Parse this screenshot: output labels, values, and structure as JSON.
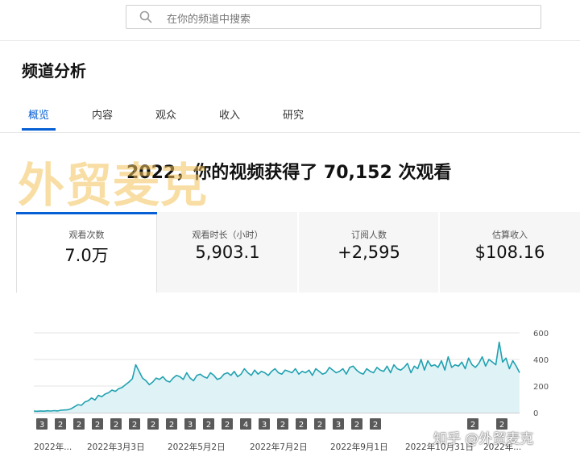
{
  "search": {
    "placeholder": "在你的频道中搜索"
  },
  "page": {
    "title": "频道分析"
  },
  "tabs": [
    {
      "label": "概览",
      "active": true
    },
    {
      "label": "内容",
      "active": false
    },
    {
      "label": "观众",
      "active": false
    },
    {
      "label": "收入",
      "active": false
    },
    {
      "label": "研究",
      "active": false
    }
  ],
  "headline": "2022，你的视频获得了 70,152 次观看",
  "watermark": {
    "text": "外贸麦克",
    "color": "#f3c45a",
    "zhihu": "知乎 @外贸麦克"
  },
  "metrics": [
    {
      "label": "观看次数",
      "value": "7.0万",
      "active": true
    },
    {
      "label": "观看时长（小时）",
      "value": "5,903.1",
      "active": false
    },
    {
      "label": "订阅人数",
      "value": "+2,595",
      "active": false
    },
    {
      "label": "估算收入",
      "value": "$108.16",
      "active": false
    }
  ],
  "colors": {
    "accent": "#065fd4",
    "line": "#21a1b0",
    "area": "#dff3f7"
  },
  "chart_data": {
    "type": "area",
    "series": [
      {
        "values": [
          12,
          10,
          13,
          11,
          14,
          12,
          15,
          13,
          18,
          20,
          22,
          30,
          45,
          60,
          55,
          80,
          90,
          110,
          95,
          130,
          120,
          140,
          150,
          170,
          160,
          180,
          190,
          210,
          230,
          255,
          360,
          310,
          260,
          240,
          210,
          230,
          260,
          250,
          270,
          240,
          230,
          260,
          280,
          270,
          250,
          300,
          260,
          240,
          280,
          290,
          270,
          260,
          300,
          280,
          250,
          260,
          290,
          300,
          280,
          310,
          270,
          290,
          330,
          300,
          280,
          320,
          290,
          310,
          300,
          280,
          310,
          330,
          300,
          290,
          320,
          310,
          300,
          330,
          290,
          310,
          300,
          320,
          280,
          330,
          310,
          290,
          300,
          340,
          320,
          300,
          310,
          330,
          290,
          340,
          350,
          320,
          300,
          290,
          330,
          310,
          300,
          340,
          320,
          310,
          350,
          300,
          360,
          330,
          320,
          340,
          370,
          300,
          350,
          330,
          400,
          320,
          390,
          350,
          360,
          340,
          390,
          320,
          420,
          340,
          360,
          350,
          380,
          330,
          410,
          360,
          340,
          370,
          420,
          350,
          400,
          380,
          360,
          530,
          380,
          410,
          330,
          390,
          350,
          300
        ]
      }
    ],
    "ylim": [
      0,
      600
    ],
    "y_ticks": [
      "600",
      "400",
      "200",
      "0"
    ],
    "x_tick_labels": [
      "2022年...",
      "2022年3月3日",
      "2022年5月2日",
      "2022年7月2日",
      "2022年9月1日",
      "2022年10月31日",
      "2022年..."
    ],
    "markers": [
      "3",
      "2",
      "2",
      "2",
      "2",
      "2",
      "2",
      "2",
      "3",
      "2",
      "2",
      "4",
      "3",
      "2",
      "2",
      "2",
      "3",
      "2",
      "2"
    ],
    "marker_extra": [
      "2"
    ],
    "grid": true
  }
}
